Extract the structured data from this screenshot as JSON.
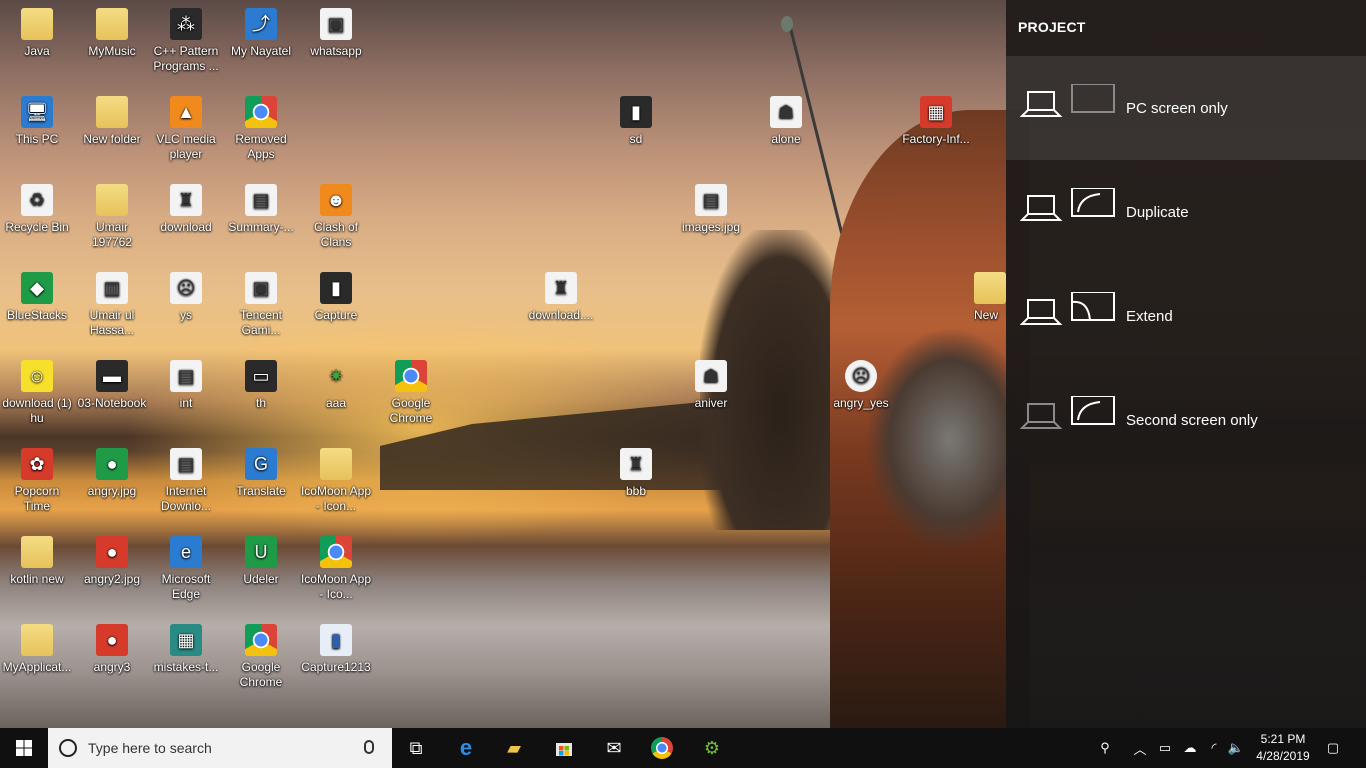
{
  "desktop_icons": [
    {
      "label": "Java"
    },
    {
      "label": "MyMusic"
    },
    {
      "label": "C++ Pattern Programs ..."
    },
    {
      "label": "My Nayatel"
    },
    {
      "label": "whatsapp"
    },
    {
      "label": "This PC"
    },
    {
      "label": "New folder"
    },
    {
      "label": "VLC media player"
    },
    {
      "label": "Removed Apps"
    },
    {
      "label": "sd"
    },
    {
      "label": "alone"
    },
    {
      "label": "Factory-Inf..."
    },
    {
      "label": "Recycle Bin"
    },
    {
      "label": "Umair 197762"
    },
    {
      "label": "download"
    },
    {
      "label": "Summary-..."
    },
    {
      "label": "Clash of Clans"
    },
    {
      "label": "images.jpg"
    },
    {
      "label": "BlueStacks"
    },
    {
      "label": "Umair ul Hassa..."
    },
    {
      "label": "ys"
    },
    {
      "label": "Tencent Gami..."
    },
    {
      "label": "Capture"
    },
    {
      "label": "download...."
    },
    {
      "label": "New"
    },
    {
      "label": "download (1) hu"
    },
    {
      "label": "03-Notebook"
    },
    {
      "label": "int"
    },
    {
      "label": "th"
    },
    {
      "label": "aaa"
    },
    {
      "label": "Google Chrome"
    },
    {
      "label": "aniver"
    },
    {
      "label": "angry_yes"
    },
    {
      "label": "Popcorn Time"
    },
    {
      "label": "angry.jpg"
    },
    {
      "label": "Internet Downlo..."
    },
    {
      "label": "Translate"
    },
    {
      "label": "IcoMoon App - Icon..."
    },
    {
      "label": "bbb"
    },
    {
      "label": "kotlin new"
    },
    {
      "label": "angry2.jpg"
    },
    {
      "label": "Microsoft Edge"
    },
    {
      "label": "Udeler"
    },
    {
      "label": "IcoMoon App - Ico..."
    },
    {
      "label": "MyApplicat..."
    },
    {
      "label": "angry3"
    },
    {
      "label": "mistakes-t..."
    },
    {
      "label": "Google Chrome"
    },
    {
      "label": "Capture1213"
    }
  ],
  "project_panel": {
    "title": "PROJECT",
    "options": [
      {
        "label": "PC screen only",
        "selected": true
      },
      {
        "label": "Duplicate",
        "selected": false
      },
      {
        "label": "Extend",
        "selected": false
      },
      {
        "label": "Second screen only",
        "selected": false
      }
    ]
  },
  "taskbar": {
    "search_placeholder": "Type here to search",
    "apps": [
      {
        "icon": "task-view-icon"
      },
      {
        "icon": "edge-icon"
      },
      {
        "icon": "file-explorer-icon"
      },
      {
        "icon": "store-icon"
      },
      {
        "icon": "mail-icon"
      },
      {
        "icon": "chrome-icon"
      },
      {
        "icon": "android-studio-icon"
      }
    ],
    "time": "5:21 PM",
    "date": "4/28/2019"
  }
}
